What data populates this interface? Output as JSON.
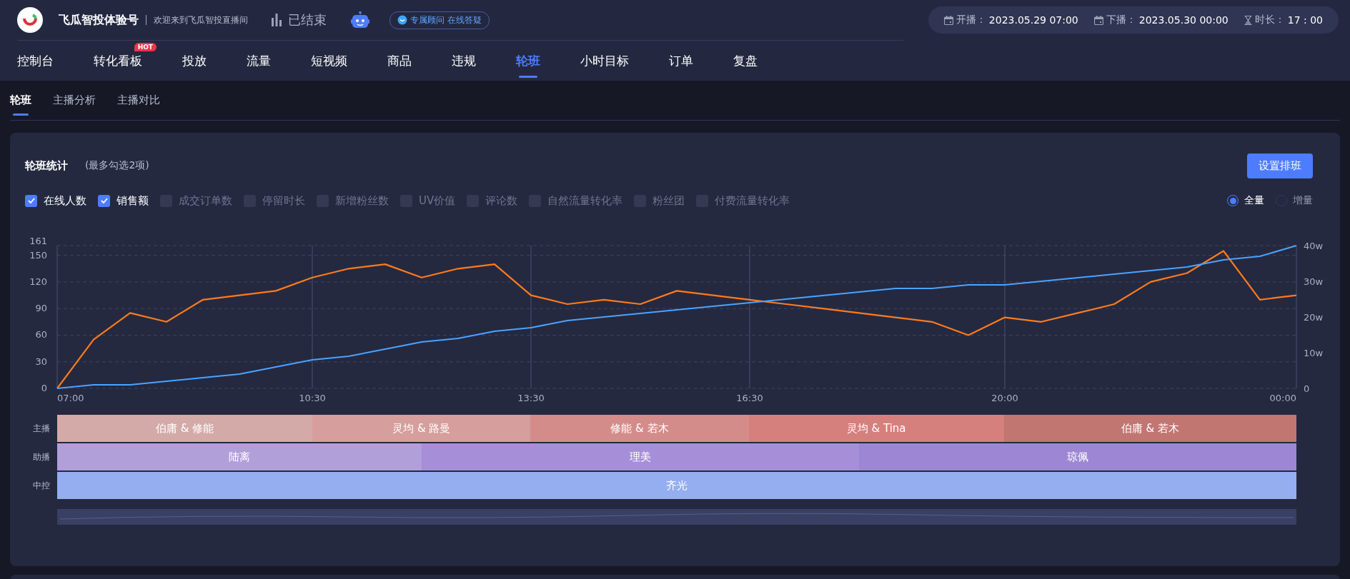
{
  "header": {
    "account_name": "飞瓜智投体验号",
    "welcome": "欢迎来到飞瓜智投直播间",
    "live_status": "已结束",
    "consultant_pill": "专属顾问 在线答疑",
    "broadcast_info": [
      {
        "kind": "calendar",
        "label": "开播：",
        "value": "2023.05.29 07:00"
      },
      {
        "kind": "calendar",
        "label": "下播：",
        "value": "2023.05.30 00:00"
      },
      {
        "kind": "hourglass",
        "label": "时长：",
        "value": "17 : 00"
      }
    ]
  },
  "nav_tabs": [
    {
      "label": "控制台",
      "selected": false
    },
    {
      "label": "转化看板",
      "selected": false,
      "badge": "HOT"
    },
    {
      "label": "投放",
      "selected": false
    },
    {
      "label": "流量",
      "selected": false
    },
    {
      "label": "短视频",
      "selected": false
    },
    {
      "label": "商品",
      "selected": false
    },
    {
      "label": "违规",
      "selected": false
    },
    {
      "label": "轮班",
      "selected": true
    },
    {
      "label": "小时目标",
      "selected": false
    },
    {
      "label": "订单",
      "selected": false
    },
    {
      "label": "复盘",
      "selected": false
    }
  ],
  "sub_tabs": [
    {
      "label": "轮班",
      "selected": true
    },
    {
      "label": "主播分析",
      "selected": false
    },
    {
      "label": "主播对比",
      "selected": false
    }
  ],
  "card": {
    "title": "轮班统计",
    "hint": "(最多勾选2项)",
    "button": "设置排班",
    "metrics": [
      {
        "label": "在线人数",
        "checked": true
      },
      {
        "label": "销售额",
        "checked": true
      },
      {
        "label": "成交订单数",
        "checked": false
      },
      {
        "label": "停留时长",
        "checked": false
      },
      {
        "label": "新增粉丝数",
        "checked": false
      },
      {
        "label": "UV价值",
        "checked": false
      },
      {
        "label": "评论数",
        "checked": false
      },
      {
        "label": "自然流量转化率",
        "checked": false
      },
      {
        "label": "粉丝团",
        "checked": false
      },
      {
        "label": "付费流量转化率",
        "checked": false
      }
    ],
    "modes": [
      {
        "label": "全量",
        "selected": true
      },
      {
        "label": "增量",
        "selected": false
      }
    ],
    "chart_data": {
      "type": "line",
      "categories": [
        "07:00",
        null,
        null,
        null,
        null,
        null,
        null,
        "10:30",
        null,
        null,
        null,
        null,
        null,
        "13:30",
        null,
        null,
        null,
        null,
        null,
        "16:30",
        null,
        null,
        null,
        null,
        null,
        null,
        "20:00",
        null,
        null,
        null,
        null,
        null,
        null,
        null,
        "00:00"
      ],
      "series": [
        {
          "color": "#ff7a1a",
          "values": [
            0,
            55,
            85,
            75,
            100,
            105,
            110,
            125,
            135,
            140,
            125,
            135,
            140,
            105,
            95,
            100,
            95,
            110,
            105,
            100,
            95,
            90,
            85,
            80,
            75,
            60,
            80,
            75,
            85,
            95,
            120,
            130,
            155,
            100,
            105
          ]
        },
        {
          "color": "#4aa3ff",
          "axis": "y2",
          "values": [
            0,
            1,
            1,
            2,
            3,
            4,
            6,
            8,
            9,
            11,
            13,
            14,
            16,
            17,
            19,
            20,
            21,
            22,
            23,
            24,
            25,
            26,
            27,
            28,
            28,
            29,
            29,
            30,
            31,
            32,
            33,
            34,
            36,
            37,
            40
          ]
        }
      ],
      "grid": true,
      "ylim": [
        0,
        161
      ],
      "yticks": [
        0,
        30,
        60,
        90,
        120,
        150,
        161
      ],
      "y2lim": [
        0,
        40
      ],
      "y2ticks": [
        {
          "value": 0,
          "label": "0"
        },
        {
          "value": 10,
          "label": "10w"
        },
        {
          "value": 20,
          "label": "20w"
        },
        {
          "value": 30,
          "label": "30w"
        },
        {
          "value": 40,
          "label": "40w"
        }
      ]
    },
    "range_slider": {
      "level": 1
    },
    "schedule": [
      {
        "role": "主播",
        "segments": [
          {
            "name": "伯庸 & 修能",
            "color": "#d4aaa8"
          },
          {
            "name": "灵均 & 路曼",
            "color": "#d69e9c"
          },
          {
            "name": "修能 & 若木",
            "color": "#d48c8a"
          },
          {
            "name": "灵均 & Tina",
            "color": "#d6807e"
          },
          {
            "name": "伯庸 & 若木",
            "color": "#c17672"
          }
        ]
      },
      {
        "role": "助播",
        "segments": [
          {
            "name": "陆离",
            "color": "#b19fda"
          },
          {
            "name": "理美",
            "color": "#a68fd8"
          },
          {
            "name": "琼佩",
            "color": "#9d87d4"
          }
        ]
      },
      {
        "role": "中控",
        "segments": [
          {
            "name": "齐光",
            "color": "#94aeef"
          }
        ]
      }
    ]
  }
}
